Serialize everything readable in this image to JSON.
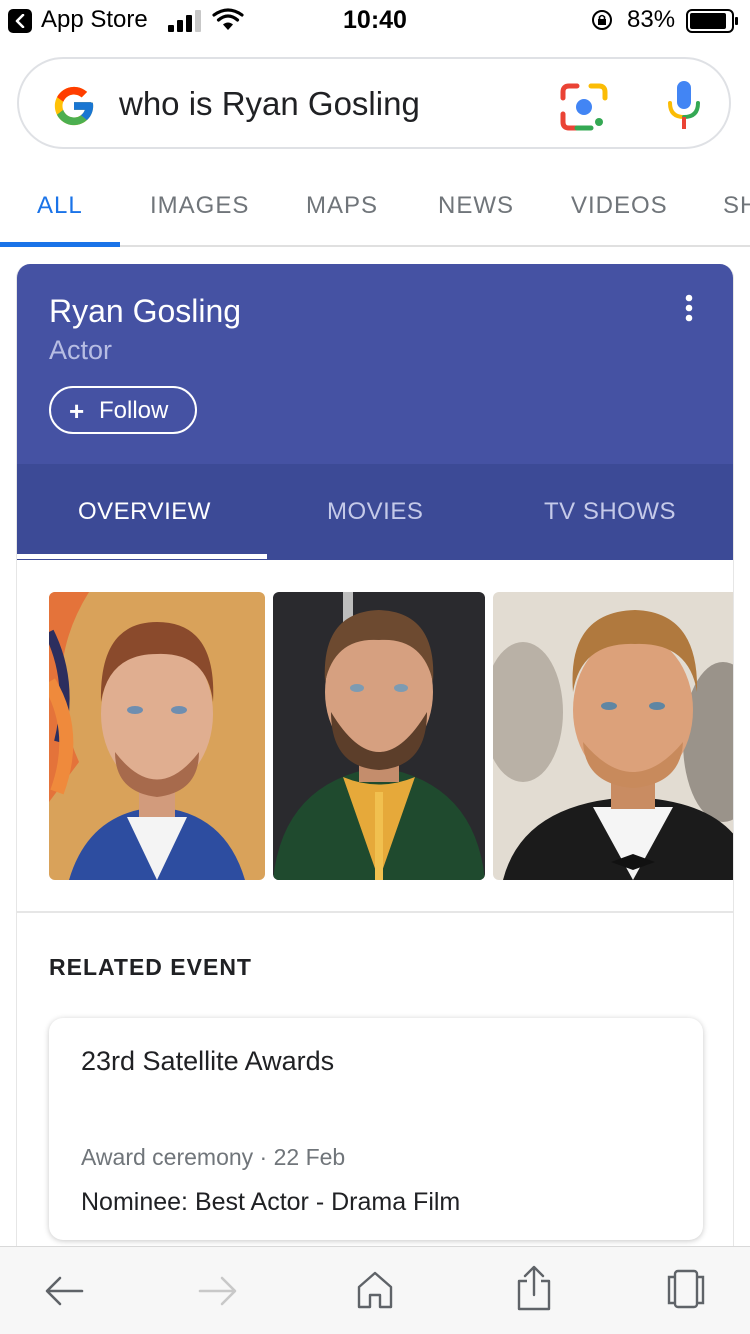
{
  "status_bar": {
    "back_app": "App Store",
    "time": "10:40",
    "battery": "83%"
  },
  "search": {
    "query": "who is Ryan Gosling"
  },
  "tabs": [
    {
      "label": "ALL",
      "active": true
    },
    {
      "label": "IMAGES",
      "active": false
    },
    {
      "label": "MAPS",
      "active": false
    },
    {
      "label": "NEWS",
      "active": false
    },
    {
      "label": "VIDEOS",
      "active": false
    },
    {
      "label": "SH",
      "active": false
    }
  ],
  "knowledge_panel": {
    "name": "Ryan Gosling",
    "description": "Actor",
    "follow_plus": "+",
    "follow_label": "Follow",
    "tabs": [
      {
        "label": "OVERVIEW",
        "active": true
      },
      {
        "label": "MOVIES",
        "active": false
      },
      {
        "label": "TV SHOWS",
        "active": false
      }
    ],
    "header_color": "#4552a3",
    "tab_bar_color": "#3c4a96"
  },
  "related_event": {
    "heading": "RELATED EVENT",
    "title": "23rd Satellite Awards",
    "meta": "Award ceremony · 22 Feb",
    "detail": "Nominee: Best Actor - Drama Film"
  },
  "colors": {
    "accent": "#1a73e8",
    "tab_inactive": "#70757a"
  },
  "icons": {
    "toolbar": [
      "back-arrow-icon",
      "forward-arrow-icon",
      "home-icon",
      "share-icon",
      "tabs-icon"
    ]
  }
}
